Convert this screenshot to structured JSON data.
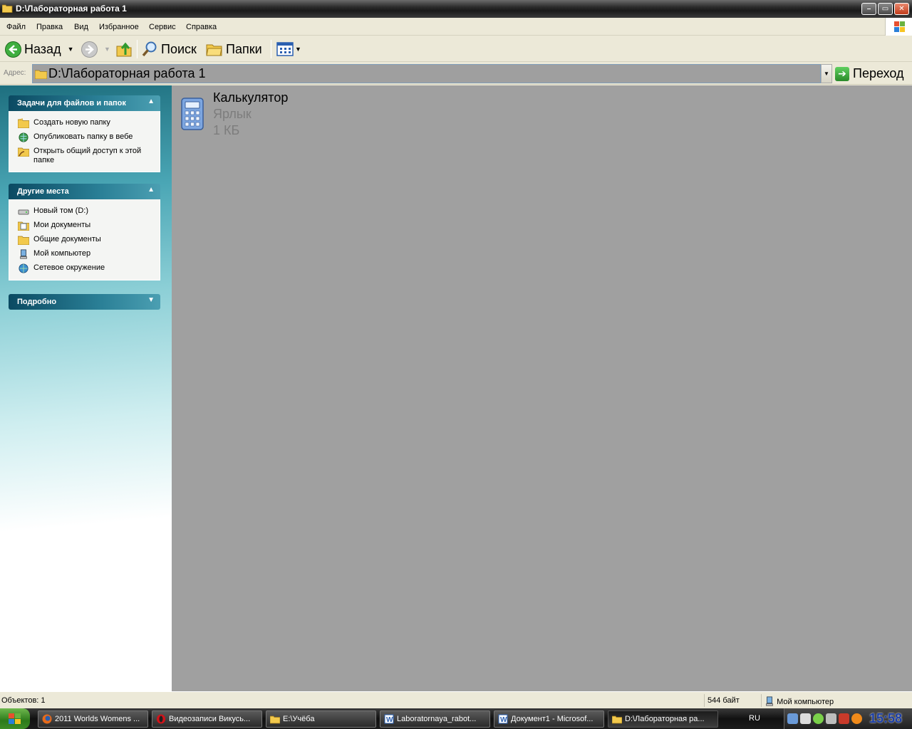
{
  "window": {
    "title": "D:\\Лабораторная работа 1",
    "buttons": {
      "minimize": "–",
      "maximize": "▭",
      "close": "✕"
    }
  },
  "menu": [
    "Файл",
    "Правка",
    "Вид",
    "Избранное",
    "Сервис",
    "Справка"
  ],
  "toolbar": {
    "back": "Назад",
    "search": "Поиск",
    "folders": "Папки"
  },
  "address": {
    "label": "Адрес:",
    "value": "D:\\Лабораторная работа 1",
    "go": "Переход"
  },
  "left_panel": {
    "tasks": {
      "title": "Задачи для файлов и папок",
      "items": [
        {
          "label": "Создать новую папку",
          "icon": "new-folder-icon"
        },
        {
          "label": "Опубликовать папку в вебе",
          "icon": "web-publish-icon"
        },
        {
          "label": "Открыть общий доступ к этой папке",
          "icon": "share-folder-icon"
        }
      ]
    },
    "places": {
      "title": "Другие места",
      "items": [
        {
          "label": "Новый том (D:)",
          "icon": "drive-icon"
        },
        {
          "label": "Мои документы",
          "icon": "my-documents-icon"
        },
        {
          "label": "Общие документы",
          "icon": "shared-documents-icon"
        },
        {
          "label": "Мой компьютер",
          "icon": "my-computer-icon"
        },
        {
          "label": "Сетевое окружение",
          "icon": "network-icon"
        }
      ]
    },
    "details": {
      "title": "Подробно"
    }
  },
  "files": [
    {
      "name": "Калькулятор",
      "type": "Ярлык",
      "size": "1 КБ",
      "icon": "calculator-icon"
    }
  ],
  "status": {
    "objects": "Объектов: 1",
    "size": "544 байт",
    "location": "Мой компьютер"
  },
  "taskbar": {
    "items": [
      {
        "label": "2011 Worlds Womens ...",
        "icon": "firefox-icon",
        "active": false
      },
      {
        "label": "Видеозаписи Викусь...",
        "icon": "opera-icon",
        "active": false
      },
      {
        "label": "E:\\Учёба",
        "icon": "folder-icon",
        "active": false
      },
      {
        "label": "Laboratornaya_rabot...",
        "icon": "word-icon",
        "active": false
      },
      {
        "label": "Документ1 - Microsof...",
        "icon": "word-icon",
        "active": false
      },
      {
        "label": "D:\\Лабораторная ра...",
        "icon": "folder-icon",
        "active": true
      }
    ],
    "language": "RU",
    "clock": "15:58"
  },
  "colors": {
    "panel_header": "#0b4a62",
    "main_background": "#a0a0a0",
    "clock": "#1c3fa8"
  }
}
